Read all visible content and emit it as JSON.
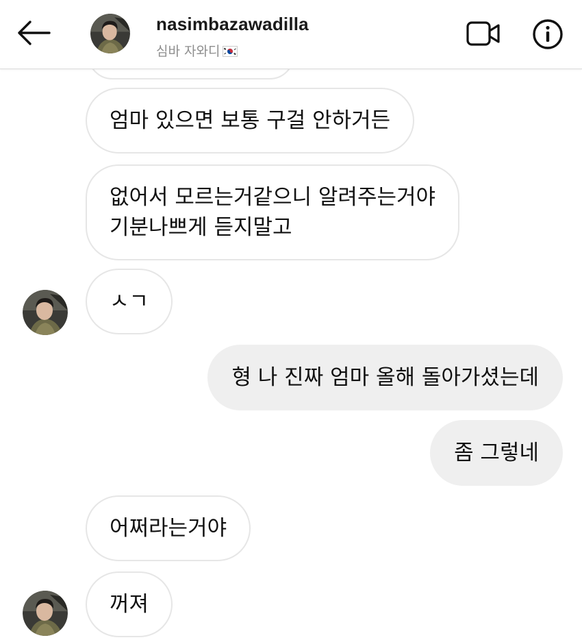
{
  "header": {
    "back_icon": "arrow-left-icon",
    "username": "nasimbazawadilla",
    "subtitle": "심바 자와디",
    "flag_icon": "south-korea-flag-icon",
    "video_icon": "video-call-icon",
    "info_icon": "info-icon"
  },
  "messages": [
    {
      "direction": "incoming",
      "text": ""
    },
    {
      "direction": "incoming",
      "text": "엄마 있으면 보통 구걸 안하거든"
    },
    {
      "direction": "incoming",
      "lines": [
        "없어서 모르는거같으니 알려주는거야",
        "기분나쁘게 듣지말고"
      ]
    },
    {
      "direction": "incoming",
      "text": "ㅅㄱ"
    },
    {
      "direction": "outgoing",
      "text": "형 나 진짜 엄마 올해 돌아가셨는데"
    },
    {
      "direction": "outgoing",
      "text": "좀 그렇네"
    },
    {
      "direction": "incoming",
      "text": "어쩌라는거야"
    },
    {
      "direction": "incoming",
      "text": "꺼져"
    }
  ],
  "colors": {
    "outgoing_bubble": "#efefef",
    "incoming_border": "#e6e6e6",
    "muted_text": "#8e8e8e",
    "flag_red": "#cd2e3a",
    "flag_blue": "#0047a0"
  }
}
